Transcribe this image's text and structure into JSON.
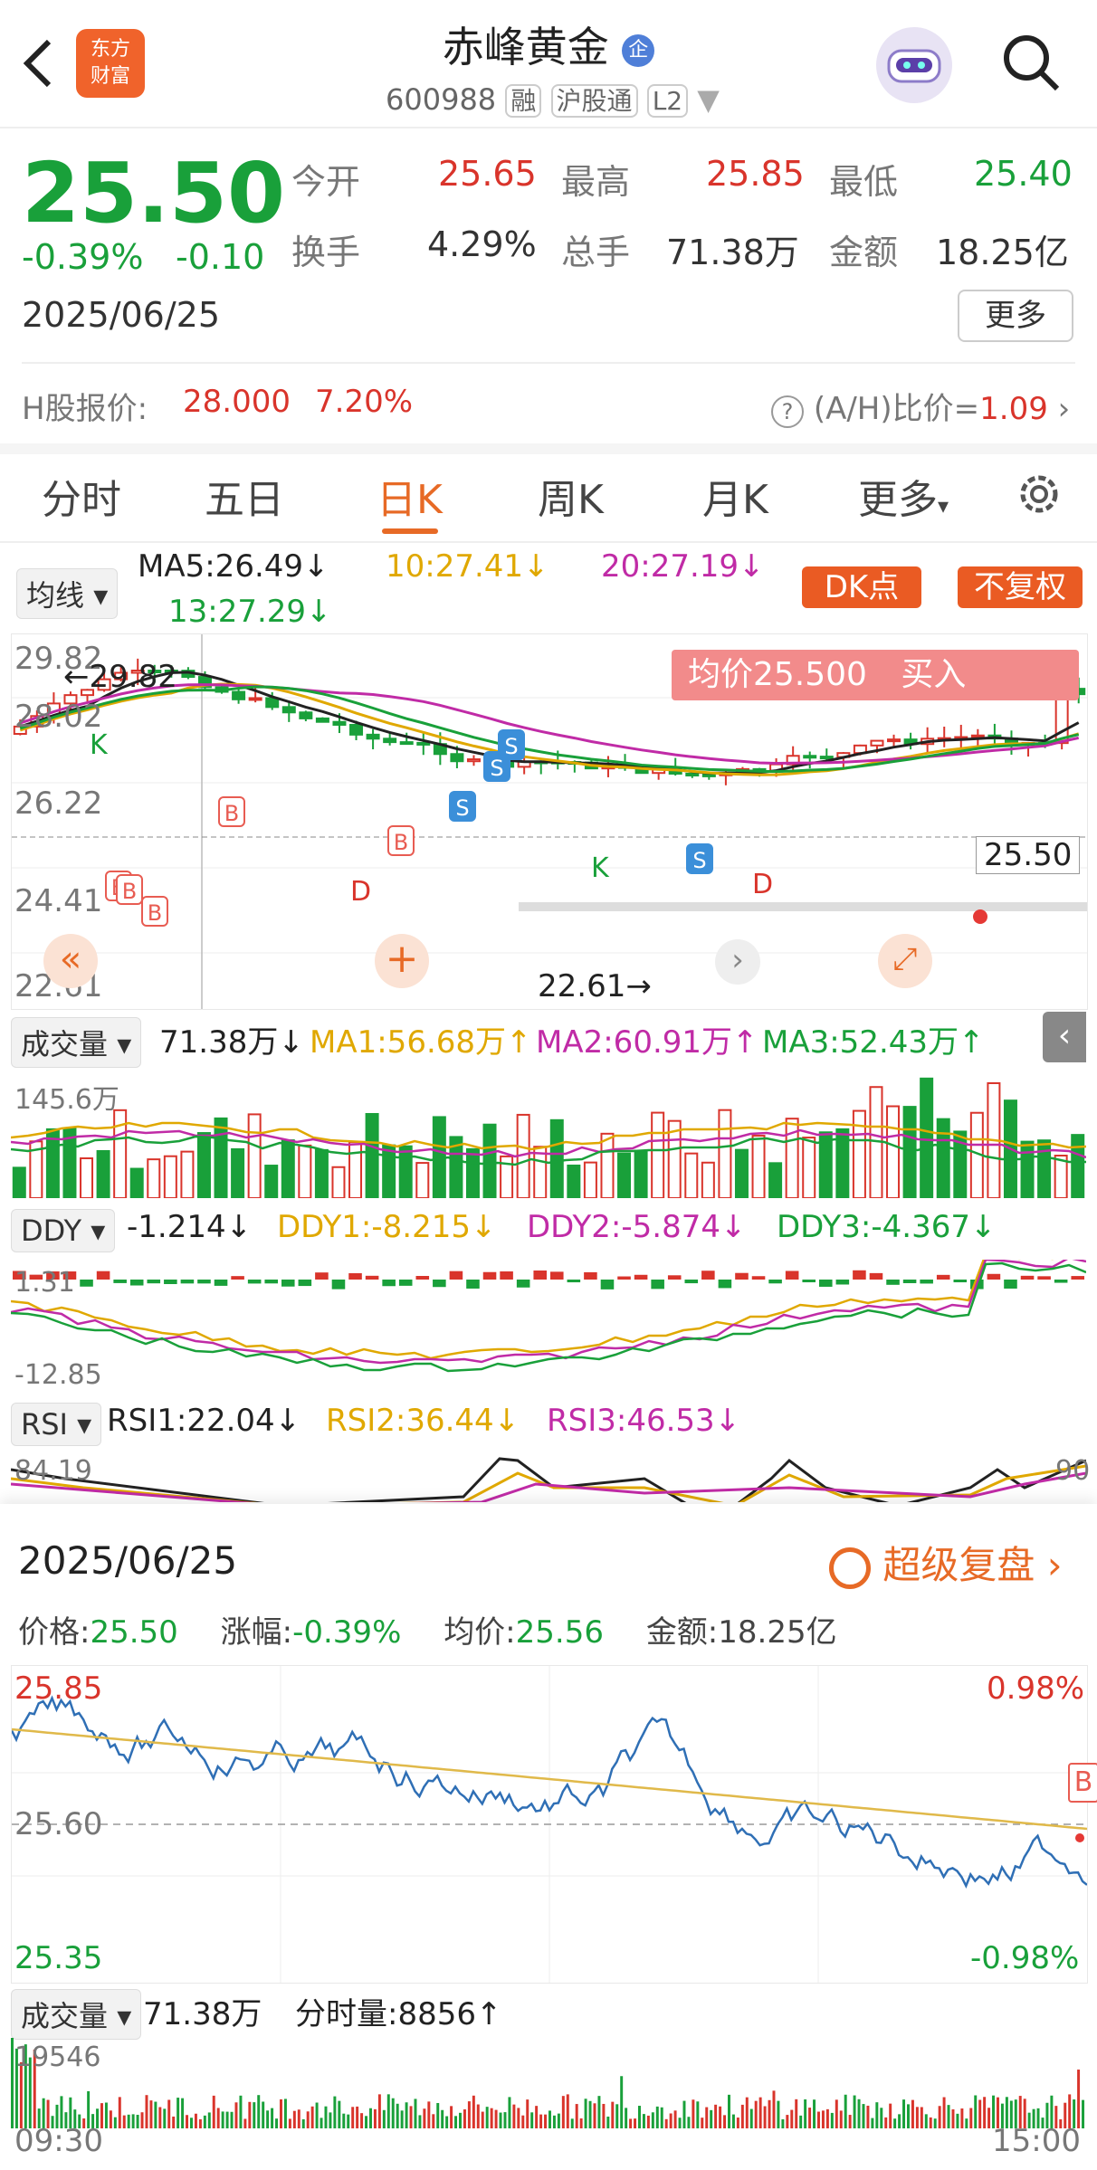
{
  "header": {
    "title": "赤峰黄金",
    "title_badge": "企",
    "code": "600988",
    "tags": [
      "融",
      "沪股通",
      "L2"
    ],
    "logo_text": "东方财富"
  },
  "quote": {
    "price": "25.50",
    "pct": "-0.39%",
    "chg": "-0.10",
    "date": "2025/06/25",
    "open_label": "今开",
    "open": "25.65",
    "high_label": "最高",
    "high": "25.85",
    "low_label": "最低",
    "low": "25.40",
    "turnover_label": "换手",
    "turnover": "4.29%",
    "volume_label": "总手",
    "volume": "71.38万",
    "amount_label": "金额",
    "amount": "18.25亿",
    "more_label": "更多"
  },
  "hshare": {
    "label": "H股报价:",
    "price": "28.000",
    "pct": "7.20%",
    "ratio_label": "(A/H)比价=",
    "ratio": "1.09"
  },
  "tabs": [
    "分时",
    "五日",
    "日K",
    "周K",
    "月K",
    "更多"
  ],
  "tabs_active": "日K",
  "ma_bar": {
    "selector": "均线",
    "ma5": "MA5:26.49↓",
    "ma10": "10:27.41↓",
    "ma20": "20:27.19↓",
    "ma13": "13:27.29↓",
    "dk_label": "DK点",
    "fuquan_label": "不复权"
  },
  "kline": {
    "y_top": "29.82",
    "y2": "28.02",
    "y3": "26.22",
    "y4": "24.41",
    "y_bottom": "22.61",
    "high_marker": "29.82",
    "low_marker": "22.61",
    "cur_price": "25.50",
    "avg_banner": "均价25.500",
    "buy_label": "买入",
    "letters": {
      "b": "B",
      "s": "S",
      "k": "K",
      "d": "D"
    }
  },
  "volume_bar": {
    "selector": "成交量",
    "value": "71.38万↓",
    "ma1": "MA1:56.68万↑",
    "ma2": "MA2:60.91万↑",
    "ma3": "MA3:52.43万↑",
    "y_top": "145.6万"
  },
  "ddy_bar": {
    "selector": "DDY",
    "value": "-1.214↓",
    "ddy1": "DDY1:-8.215↓",
    "ddy2": "DDY2:-5.874↓",
    "ddy3": "DDY3:-4.367↓",
    "y_top": "1.31",
    "y_bottom": "-12.85"
  },
  "rsi_bar": {
    "selector": "RSI",
    "rsi1": "RSI1:22.04↓",
    "rsi2": "RSI2:36.44↓",
    "rsi3": "RSI3:46.53↓",
    "y_top": "84.19",
    "y_right": "90"
  },
  "intraday": {
    "date": "2025/06/25",
    "replay": "超级复盘",
    "price_label": "价格:",
    "price": "25.50",
    "chg_label": "涨幅:",
    "chg": "-0.39%",
    "avg_label": "均价:",
    "avg": "25.56",
    "amount_label": "金额:",
    "amount": "18.25亿",
    "y_top": "25.85",
    "y_mid": "25.60",
    "y_bottom": "25.35",
    "pct_top": "0.98%",
    "pct_bottom": "-0.98%",
    "b_marker": "B"
  },
  "intraday_vol": {
    "selector": "成交量",
    "value": "71.38万",
    "fsl": "分时量:8856↑",
    "y_top": "19546",
    "t_start": "09:30",
    "t_end": "15:00"
  },
  "colors": {
    "up": "#d9342b",
    "down": "#19a03a",
    "accent": "#e76a26",
    "ma10": "#e0a800",
    "ma20": "#c02ba6",
    "ma13": "#19a03a",
    "s_blue": "#3b8fd9"
  }
}
